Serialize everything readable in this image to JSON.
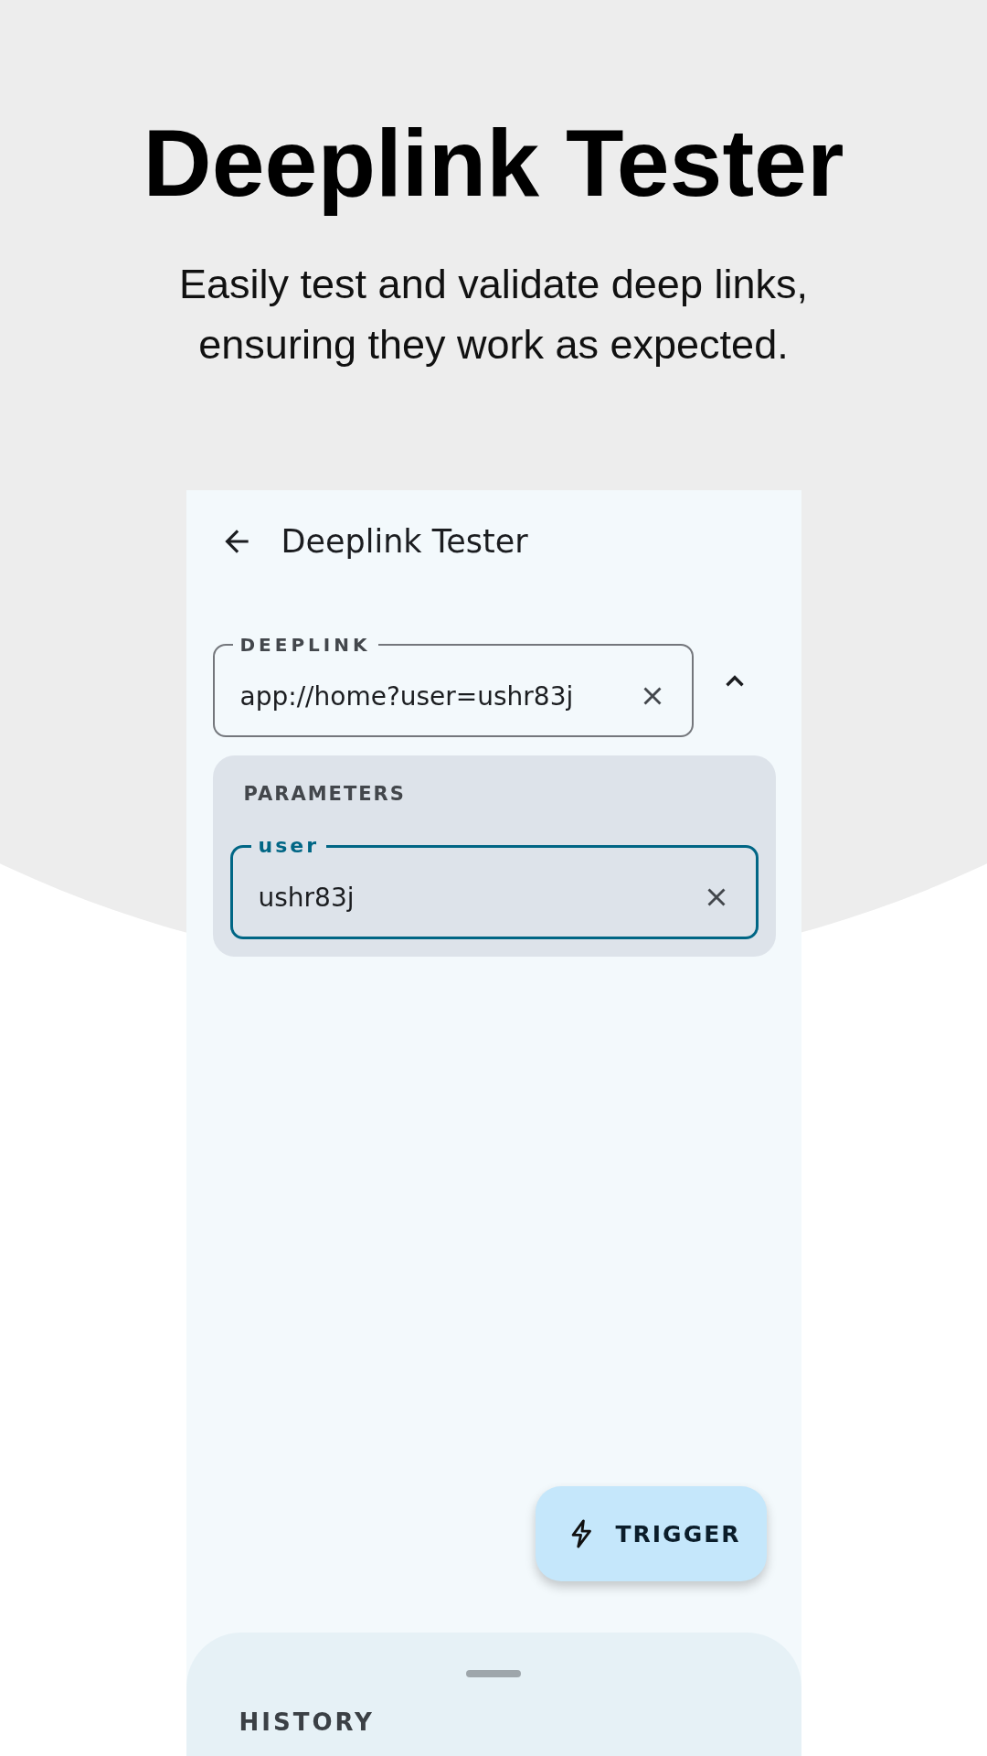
{
  "headline": "Deeplink Tester",
  "subtitle": "Easily test and validate deep links, ensuring they work as expected.",
  "app": {
    "title": "Deeplink Tester",
    "deeplink_field": {
      "label": "DEEPLINK",
      "value": "app://home?user=ushr83j"
    },
    "parameters": {
      "expanded": true,
      "title": "PARAMETERS",
      "fields": [
        {
          "label": "user",
          "value": "ushr83j",
          "focused": true
        }
      ]
    },
    "trigger_button": {
      "label": "TRIGGER"
    },
    "history": {
      "title": "HISTORY"
    }
  }
}
